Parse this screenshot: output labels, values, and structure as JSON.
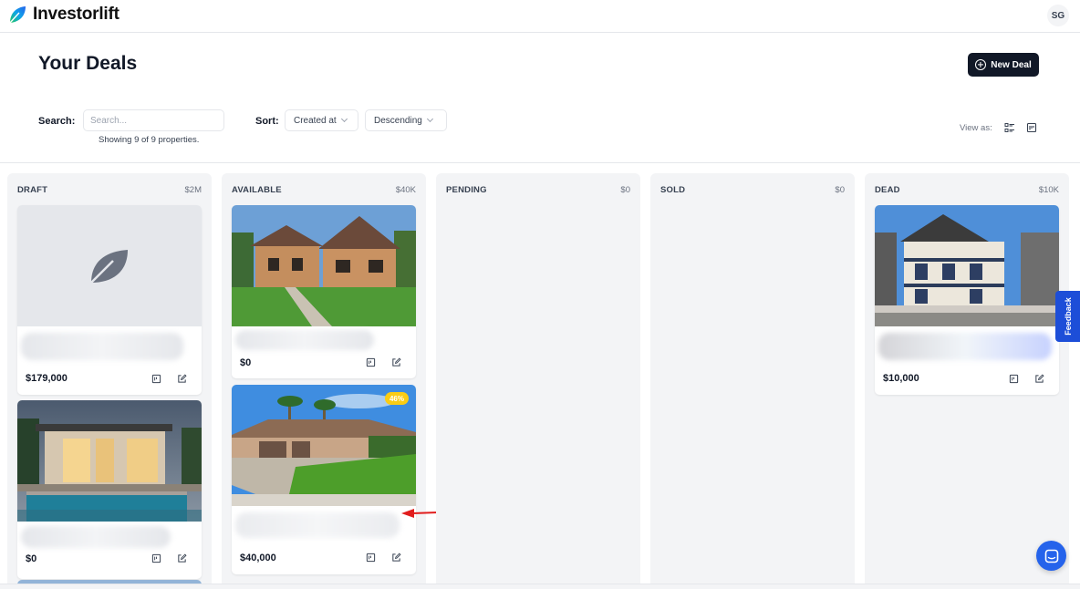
{
  "app": {
    "brand": "Investorlift",
    "user_initials": "SG"
  },
  "page": {
    "title": "Your Deals",
    "new_deal_label": "New Deal"
  },
  "filters": {
    "search_label": "Search:",
    "search_placeholder": "Search...",
    "showing_text": "Showing 9 of 9 properties.",
    "sort_label": "Sort:",
    "sort_field": "Created at",
    "sort_order": "Descending",
    "view_as_label": "View as:"
  },
  "columns": [
    {
      "name": "DRAFT",
      "total": "$2M",
      "cards": [
        {
          "price": "$179,000",
          "image": "placeholder-logo"
        },
        {
          "price": "$0",
          "image": "modern-house-pool"
        }
      ]
    },
    {
      "name": "AVAILABLE",
      "total": "$40K",
      "cards": [
        {
          "price": "$0",
          "image": "brick-house-lawn"
        },
        {
          "price": "$40,000",
          "image": "ranch-house-palms",
          "badge": "46%"
        }
      ]
    },
    {
      "name": "PENDING",
      "total": "$0",
      "cards": []
    },
    {
      "name": "SOLD",
      "total": "$0",
      "cards": []
    },
    {
      "name": "DEAD",
      "total": "$10K",
      "cards": [
        {
          "price": "$10,000",
          "image": "victorian-duplex-snow"
        }
      ]
    }
  ],
  "feedback_label": "Feedback",
  "colors": {
    "primary": "#111827",
    "accent": "#1d4ed8",
    "column_bg": "#f3f4f6",
    "badge": "#facc15"
  }
}
